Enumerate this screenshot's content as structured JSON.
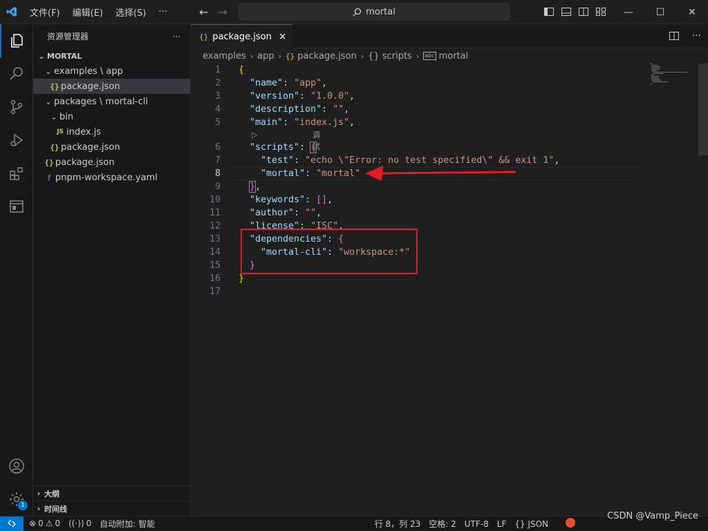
{
  "titlebar": {
    "menu": [
      "文件(F)",
      "编辑(E)",
      "选择(S)",
      "···"
    ],
    "search_text": "mortal",
    "window_controls": [
      "minimize",
      "maximize",
      "close"
    ]
  },
  "sidebar": {
    "title": "资源管理器",
    "more": "···",
    "root": "MORTAL",
    "tree": [
      {
        "label": "examples \\ app",
        "type": "folder"
      },
      {
        "label": "package.json",
        "type": "json",
        "selected": true
      },
      {
        "label": "packages \\ mortal-cli",
        "type": "folder"
      },
      {
        "label": "bin",
        "type": "folder"
      },
      {
        "label": "index.js",
        "type": "js"
      },
      {
        "label": "package.json",
        "type": "json"
      },
      {
        "label": "package.json",
        "type": "json"
      },
      {
        "label": "pnpm-workspace.yaml",
        "type": "yaml"
      }
    ],
    "footer": [
      "大纲",
      "时间线"
    ]
  },
  "editor": {
    "tab": {
      "label": "package.json",
      "close": "×"
    },
    "breadcrumb": [
      "examples",
      "app",
      "package.json",
      "scripts",
      "mortal"
    ],
    "codelens": "调试",
    "current_line": 8,
    "line_numbers": [
      "1",
      "2",
      "3",
      "4",
      "5",
      "6",
      "7",
      "8",
      "9",
      "10",
      "11",
      "12",
      "13",
      "14",
      "15",
      "16",
      "17"
    ]
  },
  "statusbar": {
    "errors": "0",
    "warnings": "0",
    "ports": "0",
    "auto_attach": "自动附加: 智能",
    "position": "行 8，列 23",
    "spaces": "空格: 2",
    "encoding": "UTF-8",
    "eol": "LF",
    "language": "{} JSON"
  },
  "watermark": "CSDN @Vamp_Piece",
  "annotations": {
    "arrow_color": "#e51c23",
    "box_color": "#e51c23"
  },
  "colors": {
    "accent": "#0078d4",
    "key": "#9cdcfe",
    "string": "#ce9178"
  }
}
